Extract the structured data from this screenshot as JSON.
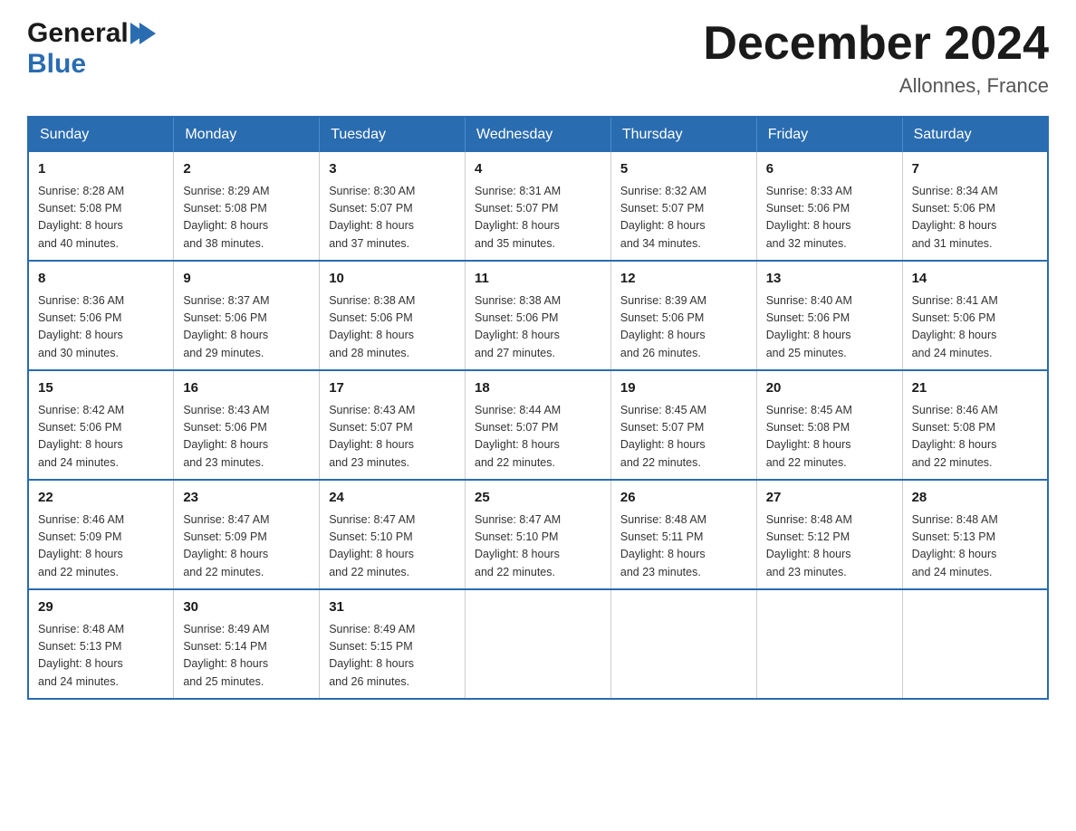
{
  "header": {
    "title": "December 2024",
    "subtitle": "Allonnes, France",
    "logo_general": "General",
    "logo_blue": "Blue"
  },
  "calendar": {
    "days_of_week": [
      "Sunday",
      "Monday",
      "Tuesday",
      "Wednesday",
      "Thursday",
      "Friday",
      "Saturday"
    ],
    "weeks": [
      [
        {
          "day": "1",
          "sunrise": "Sunrise: 8:28 AM",
          "sunset": "Sunset: 5:08 PM",
          "daylight": "Daylight: 8 hours",
          "minutes": "and 40 minutes."
        },
        {
          "day": "2",
          "sunrise": "Sunrise: 8:29 AM",
          "sunset": "Sunset: 5:08 PM",
          "daylight": "Daylight: 8 hours",
          "minutes": "and 38 minutes."
        },
        {
          "day": "3",
          "sunrise": "Sunrise: 8:30 AM",
          "sunset": "Sunset: 5:07 PM",
          "daylight": "Daylight: 8 hours",
          "minutes": "and 37 minutes."
        },
        {
          "day": "4",
          "sunrise": "Sunrise: 8:31 AM",
          "sunset": "Sunset: 5:07 PM",
          "daylight": "Daylight: 8 hours",
          "minutes": "and 35 minutes."
        },
        {
          "day": "5",
          "sunrise": "Sunrise: 8:32 AM",
          "sunset": "Sunset: 5:07 PM",
          "daylight": "Daylight: 8 hours",
          "minutes": "and 34 minutes."
        },
        {
          "day": "6",
          "sunrise": "Sunrise: 8:33 AM",
          "sunset": "Sunset: 5:06 PM",
          "daylight": "Daylight: 8 hours",
          "minutes": "and 32 minutes."
        },
        {
          "day": "7",
          "sunrise": "Sunrise: 8:34 AM",
          "sunset": "Sunset: 5:06 PM",
          "daylight": "Daylight: 8 hours",
          "minutes": "and 31 minutes."
        }
      ],
      [
        {
          "day": "8",
          "sunrise": "Sunrise: 8:36 AM",
          "sunset": "Sunset: 5:06 PM",
          "daylight": "Daylight: 8 hours",
          "minutes": "and 30 minutes."
        },
        {
          "day": "9",
          "sunrise": "Sunrise: 8:37 AM",
          "sunset": "Sunset: 5:06 PM",
          "daylight": "Daylight: 8 hours",
          "minutes": "and 29 minutes."
        },
        {
          "day": "10",
          "sunrise": "Sunrise: 8:38 AM",
          "sunset": "Sunset: 5:06 PM",
          "daylight": "Daylight: 8 hours",
          "minutes": "and 28 minutes."
        },
        {
          "day": "11",
          "sunrise": "Sunrise: 8:38 AM",
          "sunset": "Sunset: 5:06 PM",
          "daylight": "Daylight: 8 hours",
          "minutes": "and 27 minutes."
        },
        {
          "day": "12",
          "sunrise": "Sunrise: 8:39 AM",
          "sunset": "Sunset: 5:06 PM",
          "daylight": "Daylight: 8 hours",
          "minutes": "and 26 minutes."
        },
        {
          "day": "13",
          "sunrise": "Sunrise: 8:40 AM",
          "sunset": "Sunset: 5:06 PM",
          "daylight": "Daylight: 8 hours",
          "minutes": "and 25 minutes."
        },
        {
          "day": "14",
          "sunrise": "Sunrise: 8:41 AM",
          "sunset": "Sunset: 5:06 PM",
          "daylight": "Daylight: 8 hours",
          "minutes": "and 24 minutes."
        }
      ],
      [
        {
          "day": "15",
          "sunrise": "Sunrise: 8:42 AM",
          "sunset": "Sunset: 5:06 PM",
          "daylight": "Daylight: 8 hours",
          "minutes": "and 24 minutes."
        },
        {
          "day": "16",
          "sunrise": "Sunrise: 8:43 AM",
          "sunset": "Sunset: 5:06 PM",
          "daylight": "Daylight: 8 hours",
          "minutes": "and 23 minutes."
        },
        {
          "day": "17",
          "sunrise": "Sunrise: 8:43 AM",
          "sunset": "Sunset: 5:07 PM",
          "daylight": "Daylight: 8 hours",
          "minutes": "and 23 minutes."
        },
        {
          "day": "18",
          "sunrise": "Sunrise: 8:44 AM",
          "sunset": "Sunset: 5:07 PM",
          "daylight": "Daylight: 8 hours",
          "minutes": "and 22 minutes."
        },
        {
          "day": "19",
          "sunrise": "Sunrise: 8:45 AM",
          "sunset": "Sunset: 5:07 PM",
          "daylight": "Daylight: 8 hours",
          "minutes": "and 22 minutes."
        },
        {
          "day": "20",
          "sunrise": "Sunrise: 8:45 AM",
          "sunset": "Sunset: 5:08 PM",
          "daylight": "Daylight: 8 hours",
          "minutes": "and 22 minutes."
        },
        {
          "day": "21",
          "sunrise": "Sunrise: 8:46 AM",
          "sunset": "Sunset: 5:08 PM",
          "daylight": "Daylight: 8 hours",
          "minutes": "and 22 minutes."
        }
      ],
      [
        {
          "day": "22",
          "sunrise": "Sunrise: 8:46 AM",
          "sunset": "Sunset: 5:09 PM",
          "daylight": "Daylight: 8 hours",
          "minutes": "and 22 minutes."
        },
        {
          "day": "23",
          "sunrise": "Sunrise: 8:47 AM",
          "sunset": "Sunset: 5:09 PM",
          "daylight": "Daylight: 8 hours",
          "minutes": "and 22 minutes."
        },
        {
          "day": "24",
          "sunrise": "Sunrise: 8:47 AM",
          "sunset": "Sunset: 5:10 PM",
          "daylight": "Daylight: 8 hours",
          "minutes": "and 22 minutes."
        },
        {
          "day": "25",
          "sunrise": "Sunrise: 8:47 AM",
          "sunset": "Sunset: 5:10 PM",
          "daylight": "Daylight: 8 hours",
          "minutes": "and 22 minutes."
        },
        {
          "day": "26",
          "sunrise": "Sunrise: 8:48 AM",
          "sunset": "Sunset: 5:11 PM",
          "daylight": "Daylight: 8 hours",
          "minutes": "and 23 minutes."
        },
        {
          "day": "27",
          "sunrise": "Sunrise: 8:48 AM",
          "sunset": "Sunset: 5:12 PM",
          "daylight": "Daylight: 8 hours",
          "minutes": "and 23 minutes."
        },
        {
          "day": "28",
          "sunrise": "Sunrise: 8:48 AM",
          "sunset": "Sunset: 5:13 PM",
          "daylight": "Daylight: 8 hours",
          "minutes": "and 24 minutes."
        }
      ],
      [
        {
          "day": "29",
          "sunrise": "Sunrise: 8:48 AM",
          "sunset": "Sunset: 5:13 PM",
          "daylight": "Daylight: 8 hours",
          "minutes": "and 24 minutes."
        },
        {
          "day": "30",
          "sunrise": "Sunrise: 8:49 AM",
          "sunset": "Sunset: 5:14 PM",
          "daylight": "Daylight: 8 hours",
          "minutes": "and 25 minutes."
        },
        {
          "day": "31",
          "sunrise": "Sunrise: 8:49 AM",
          "sunset": "Sunset: 5:15 PM",
          "daylight": "Daylight: 8 hours",
          "minutes": "and 26 minutes."
        },
        null,
        null,
        null,
        null
      ]
    ]
  }
}
